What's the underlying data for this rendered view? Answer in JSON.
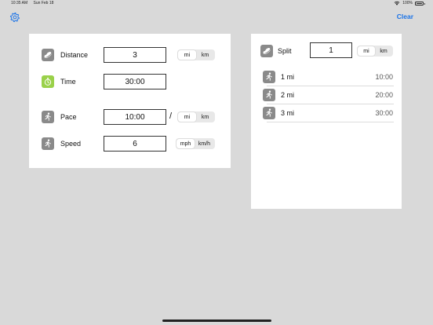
{
  "status_bar": {
    "time": "10:35 AM",
    "date": "Sun Feb 18",
    "battery": "100%",
    "wifi_icon": "wifi-icon",
    "battery_icon": "battery-icon"
  },
  "toolbar": {
    "settings_icon": "gear-icon",
    "clear_label": "Clear",
    "accent_color": "#1a73e8"
  },
  "calculator": {
    "distance": {
      "label": "Distance",
      "value": "3",
      "icon": "shoe-icon",
      "units": [
        {
          "label": "mi",
          "selected": true
        },
        {
          "label": "km",
          "selected": false
        }
      ]
    },
    "time": {
      "label": "Time",
      "value": "30:00",
      "icon": "stopwatch-icon",
      "icon_color": "#9ad14a"
    },
    "pace": {
      "label": "Pace",
      "value": "10:00",
      "separator": "/",
      "icon": "runner-icon",
      "units": [
        {
          "label": "mi",
          "selected": true
        },
        {
          "label": "km",
          "selected": false
        }
      ]
    },
    "speed": {
      "label": "Speed",
      "value": "6",
      "icon": "runner-icon",
      "units": [
        {
          "label": "mph",
          "selected": true
        },
        {
          "label": "km/h",
          "selected": false
        }
      ]
    }
  },
  "splits": {
    "label": "Split",
    "value": "1",
    "icon": "shoe-icon",
    "units": [
      {
        "label": "mi",
        "selected": true
      },
      {
        "label": "km",
        "selected": false
      }
    ],
    "rows": [
      {
        "label": "1 mi",
        "time": "10:00",
        "icon": "runner-icon"
      },
      {
        "label": "2 mi",
        "time": "20:00",
        "icon": "runner-icon"
      },
      {
        "label": "3 mi",
        "time": "30:00",
        "icon": "runner-icon"
      }
    ]
  }
}
